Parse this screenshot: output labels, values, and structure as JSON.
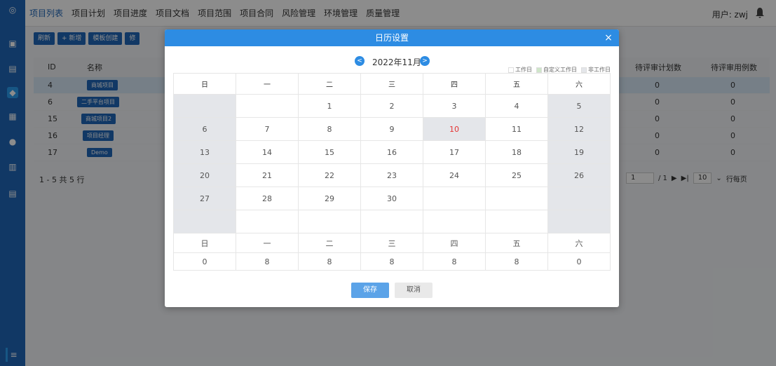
{
  "app": {
    "nav": [
      "项目列表",
      "项目计划",
      "项目进度",
      "项目文档",
      "项目范围",
      "项目合同",
      "风险管理",
      "环境管理",
      "质量管理"
    ],
    "user_label": "用户: zwj",
    "toolbar": [
      "刷新",
      "+ 新增",
      "模板创建",
      "修"
    ],
    "table_headers": [
      "ID",
      "名称",
      "待评审计划数",
      "待评审用例数"
    ],
    "rows": [
      {
        "id": "4",
        "name": "商城项目",
        "plans": "0",
        "cases": "0"
      },
      {
        "id": "6",
        "name": "二手平台项目",
        "plans": "0",
        "cases": "0"
      },
      {
        "id": "15",
        "name": "商城项目2",
        "plans": "0",
        "cases": "0"
      },
      {
        "id": "16",
        "name": "项目经理",
        "plans": "0",
        "cases": "0"
      },
      {
        "id": "17",
        "name": "Demo",
        "plans": "0",
        "cases": "0"
      }
    ],
    "pager_text": "1 - 5 共 5 行",
    "pager_page": "1",
    "pager_total": "/ 1",
    "pager_size": "10",
    "pager_suffix": "行每页"
  },
  "modal": {
    "title": "日历设置",
    "close": "×",
    "month": "2022年11月",
    "prev": "<",
    "next": ">",
    "legend": [
      "工作日",
      "自定义工作日",
      "非工作日"
    ],
    "weekdays": [
      "日",
      "一",
      "二",
      "三",
      "四",
      "五",
      "六"
    ],
    "weeks": [
      [
        "",
        "",
        "1",
        "2",
        "3",
        "4",
        "5"
      ],
      [
        "6",
        "7",
        "8",
        "9",
        "10",
        "11",
        "12"
      ],
      [
        "13",
        "14",
        "15",
        "16",
        "17",
        "18",
        "19"
      ],
      [
        "20",
        "21",
        "22",
        "23",
        "24",
        "25",
        "26"
      ],
      [
        "27",
        "28",
        "29",
        "30",
        "",
        "",
        ""
      ],
      [
        "",
        "",
        "",
        "",
        "",
        "",
        ""
      ]
    ],
    "summary_weekdays": [
      "日",
      "一",
      "二",
      "三",
      "四",
      "五",
      "六"
    ],
    "summary_hours": [
      "0",
      "8",
      "8",
      "8",
      "8",
      "8",
      "0"
    ],
    "save": "保存",
    "cancel": "取消"
  }
}
